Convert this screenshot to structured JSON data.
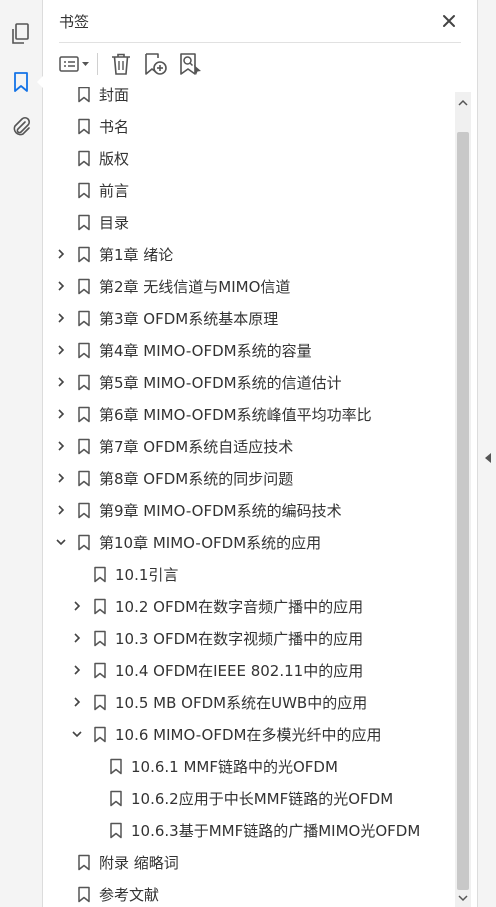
{
  "panel": {
    "title": "书签"
  },
  "bookmarks": [
    {
      "label": "封面",
      "level": 0,
      "expander": "none"
    },
    {
      "label": "书名",
      "level": 0,
      "expander": "none"
    },
    {
      "label": "版权",
      "level": 0,
      "expander": "none"
    },
    {
      "label": "前言",
      "level": 0,
      "expander": "none"
    },
    {
      "label": "目录",
      "level": 0,
      "expander": "none"
    },
    {
      "label": "第1章  绪论",
      "level": 0,
      "expander": "collapsed"
    },
    {
      "label": "第2章  无线信道与MIMO信道",
      "level": 0,
      "expander": "collapsed"
    },
    {
      "label": "第3章  OFDM系统基本原理",
      "level": 0,
      "expander": "collapsed"
    },
    {
      "label": "第4章  MIMO-OFDM系统的容量",
      "level": 0,
      "expander": "collapsed"
    },
    {
      "label": "第5章  MIMO-OFDM系统的信道估计",
      "level": 0,
      "expander": "collapsed"
    },
    {
      "label": "第6章  MIMO-OFDM系统峰值平均功率比",
      "level": 0,
      "expander": "collapsed"
    },
    {
      "label": "第7章  OFDM系统自适应技术",
      "level": 0,
      "expander": "collapsed"
    },
    {
      "label": "第8章  OFDM系统的同步问题",
      "level": 0,
      "expander": "collapsed"
    },
    {
      "label": "第9章  MIMO-OFDM系统的编码技术",
      "level": 0,
      "expander": "collapsed"
    },
    {
      "label": "第10章  MIMO-OFDM系统的应用",
      "level": 0,
      "expander": "expanded"
    },
    {
      "label": "10.1引言",
      "level": 1,
      "expander": "none"
    },
    {
      "label": "10.2  OFDM在数字音频广播中的应用",
      "level": 1,
      "expander": "collapsed"
    },
    {
      "label": "10.3  OFDM在数字视频广播中的应用",
      "level": 1,
      "expander": "collapsed"
    },
    {
      "label": "10.4  OFDM在IEEE 802.11中的应用",
      "level": 1,
      "expander": "collapsed"
    },
    {
      "label": "10.5  MB OFDM系统在UWB中的应用",
      "level": 1,
      "expander": "collapsed"
    },
    {
      "label": "10.6  MIMO-OFDM在多模光纤中的应用",
      "level": 1,
      "expander": "expanded"
    },
    {
      "label": "10.6.1  MMF链路中的光OFDM",
      "level": 2,
      "expander": "none"
    },
    {
      "label": "10.6.2应用于中长MMF链路的光OFDM",
      "level": 2,
      "expander": "none"
    },
    {
      "label": "10.6.3基于MMF链路的广播MIMO光OFDM",
      "level": 2,
      "expander": "none"
    },
    {
      "label": "附录  缩略词",
      "level": 0,
      "expander": "none"
    },
    {
      "label": "参考文献",
      "level": 0,
      "expander": "none"
    }
  ],
  "icons": {
    "rail": [
      "pages-icon",
      "bookmark-icon",
      "attachment-icon"
    ],
    "toolbar": [
      "options-menu-icon",
      "delete-icon",
      "new-bookmark-icon",
      "bookmark-search-icon"
    ]
  },
  "colors": {
    "accent": "#1473e6",
    "panel_bg": "#ffffff",
    "rail_bg": "#f4f4f4",
    "text": "#333333",
    "icon": "#555555"
  }
}
